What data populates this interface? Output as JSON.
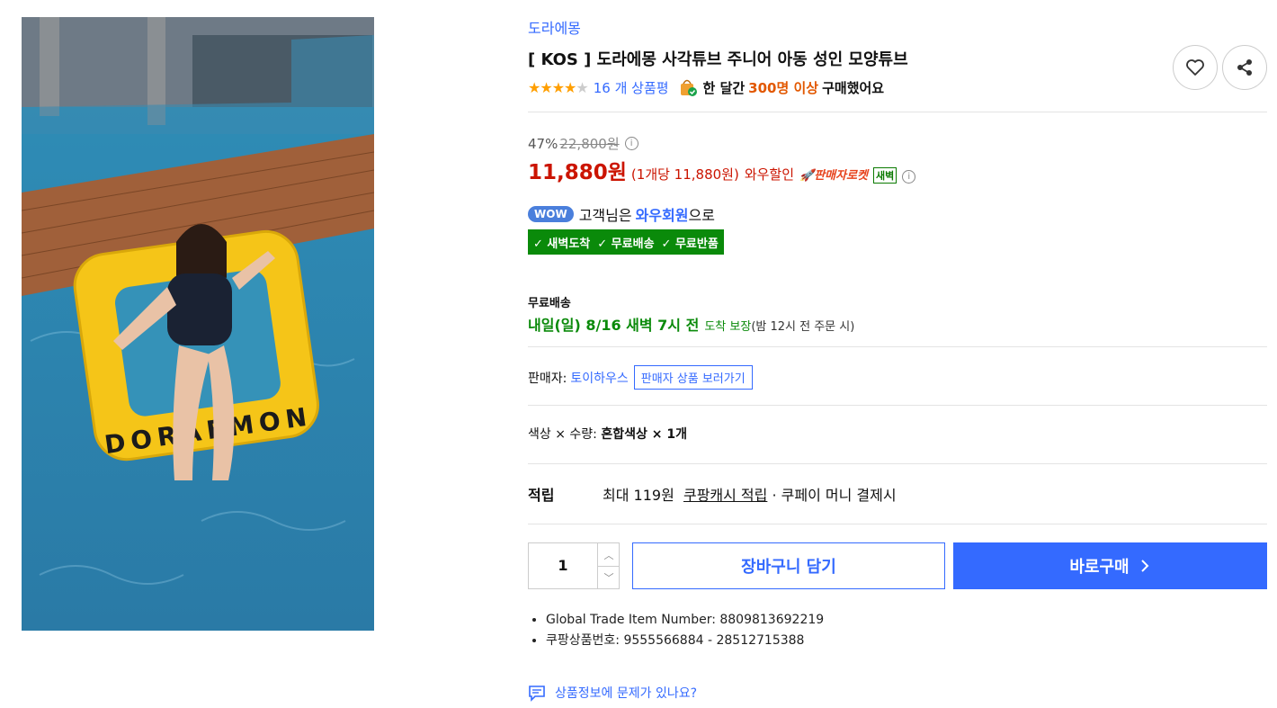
{
  "product": {
    "brand": "도라에몽",
    "title": "[ KOS ] 도라에몽 사각튜브 주니어 아동 성인 모양튜브",
    "rating_stars": 4,
    "review_count_text": "16 개 상품평",
    "bought_prefix": "한 달간",
    "bought_highlight": "300명 이상",
    "bought_suffix": "구매했어요",
    "image_lettering": "DORAEMON"
  },
  "icons": {
    "wishlist": "heart-icon",
    "share": "share-icon",
    "info": "info-icon",
    "chevron": "chevron-right-icon"
  },
  "price": {
    "discount_rate": "47%",
    "original": "22,800원",
    "sale": "11,880원",
    "unit_price": "(1개당 11,880원)",
    "wow_label": "와우할인",
    "rocket_label": "판매자로켓",
    "dawn_tag": "새벽"
  },
  "wow": {
    "badge": "WOW",
    "text_prefix": "고객님은",
    "text_strong": "와우회원",
    "text_suffix": "으로",
    "benefits": [
      "✓ 새벽도착",
      "✓ 무료배송",
      "✓ 무료반품"
    ]
  },
  "shipping": {
    "label": "무료배송",
    "date": "내일(일) 8/16 새벽 7시 전",
    "guarantee": "도착 보장",
    "note": "(밤 12시 전 주문 시)"
  },
  "seller": {
    "label": "판매자:",
    "name": "토이하우스",
    "button": "판매자 상품 보러가기"
  },
  "option": {
    "label": "색상 × 수량:",
    "value": "혼합색상 × 1개"
  },
  "reward": {
    "label": "적립",
    "prefix": "최대 119원",
    "link": "쿠팡캐시 적립",
    "suffix": "· 쿠페이 머니 결제시"
  },
  "purchase": {
    "quantity": "1",
    "cart_label": "장바구니 담기",
    "buy_label": "바로구매"
  },
  "specs": [
    "Global Trade Item Number: 8809813692219",
    "쿠팡상품번호: 9555566884 - 28512715388"
  ],
  "report_link": "상품정보에 문제가 있나요?",
  "colors": {
    "accent": "#346aff",
    "price": "#cb1400",
    "green": "#0a8a0a",
    "highlight": "#e25800"
  }
}
